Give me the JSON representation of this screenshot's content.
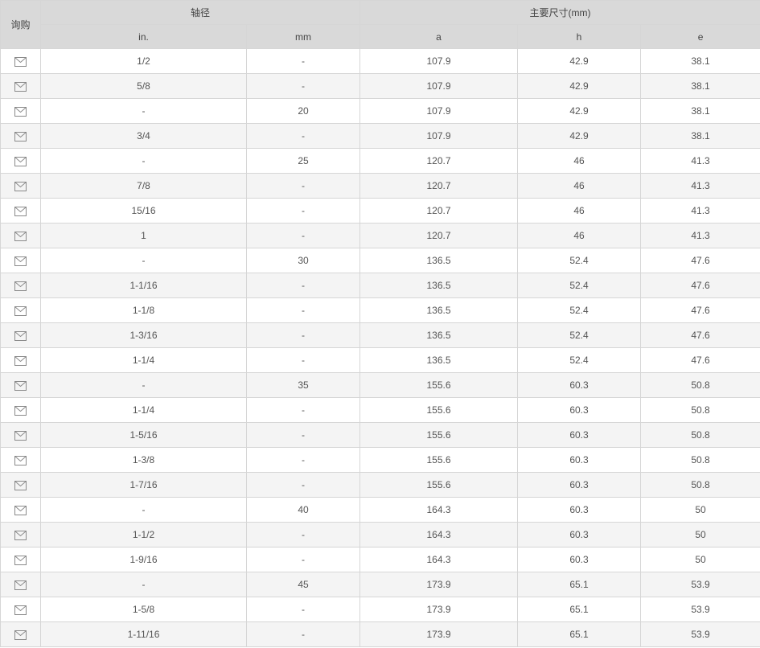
{
  "header": {
    "inquiry": "询购",
    "shaft_diameter": "轴径",
    "main_dims": "主要尺寸(mm)",
    "cols": [
      "in.",
      "mm",
      "a",
      "h",
      "e"
    ]
  },
  "icons": {
    "inquiry": "mail-icon"
  },
  "rows": [
    {
      "in": "1/2",
      "mm": "-",
      "a": "107.9",
      "h": "42.9",
      "e": "38.1"
    },
    {
      "in": "5/8",
      "mm": "-",
      "a": "107.9",
      "h": "42.9",
      "e": "38.1"
    },
    {
      "in": "-",
      "mm": "20",
      "a": "107.9",
      "h": "42.9",
      "e": "38.1"
    },
    {
      "in": "3/4",
      "mm": "-",
      "a": "107.9",
      "h": "42.9",
      "e": "38.1"
    },
    {
      "in": "-",
      "mm": "25",
      "a": "120.7",
      "h": "46",
      "e": "41.3"
    },
    {
      "in": "7/8",
      "mm": "-",
      "a": "120.7",
      "h": "46",
      "e": "41.3"
    },
    {
      "in": "15/16",
      "mm": "-",
      "a": "120.7",
      "h": "46",
      "e": "41.3"
    },
    {
      "in": "1",
      "mm": "-",
      "a": "120.7",
      "h": "46",
      "e": "41.3"
    },
    {
      "in": "-",
      "mm": "30",
      "a": "136.5",
      "h": "52.4",
      "e": "47.6"
    },
    {
      "in": "1-1/16",
      "mm": "-",
      "a": "136.5",
      "h": "52.4",
      "e": "47.6"
    },
    {
      "in": "1-1/8",
      "mm": "-",
      "a": "136.5",
      "h": "52.4",
      "e": "47.6"
    },
    {
      "in": "1-3/16",
      "mm": "-",
      "a": "136.5",
      "h": "52.4",
      "e": "47.6"
    },
    {
      "in": "1-1/4",
      "mm": "-",
      "a": "136.5",
      "h": "52.4",
      "e": "47.6"
    },
    {
      "in": "-",
      "mm": "35",
      "a": "155.6",
      "h": "60.3",
      "e": "50.8"
    },
    {
      "in": "1-1/4",
      "mm": "-",
      "a": "155.6",
      "h": "60.3",
      "e": "50.8"
    },
    {
      "in": "1-5/16",
      "mm": "-",
      "a": "155.6",
      "h": "60.3",
      "e": "50.8"
    },
    {
      "in": "1-3/8",
      "mm": "-",
      "a": "155.6",
      "h": "60.3",
      "e": "50.8"
    },
    {
      "in": "1-7/16",
      "mm": "-",
      "a": "155.6",
      "h": "60.3",
      "e": "50.8"
    },
    {
      "in": "-",
      "mm": "40",
      "a": "164.3",
      "h": "60.3",
      "e": "50"
    },
    {
      "in": "1-1/2",
      "mm": "-",
      "a": "164.3",
      "h": "60.3",
      "e": "50"
    },
    {
      "in": "1-9/16",
      "mm": "-",
      "a": "164.3",
      "h": "60.3",
      "e": "50"
    },
    {
      "in": "-",
      "mm": "45",
      "a": "173.9",
      "h": "65.1",
      "e": "53.9"
    },
    {
      "in": "1-5/8",
      "mm": "-",
      "a": "173.9",
      "h": "65.1",
      "e": "53.9"
    },
    {
      "in": "1-11/16",
      "mm": "-",
      "a": "173.9",
      "h": "65.1",
      "e": "53.9"
    }
  ]
}
